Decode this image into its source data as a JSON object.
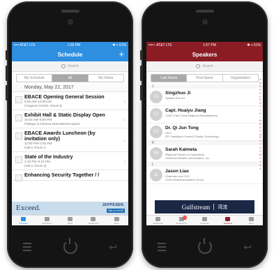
{
  "left": {
    "status": {
      "carrier": "•••• AT&T  LTE",
      "time": "1:58 PM",
      "battery": "✱ ⌖ 61%"
    },
    "title": "Schedule",
    "add_label": "+",
    "search_placeholder": "Search",
    "segments": [
      "My Schedule",
      "All",
      "My Notes"
    ],
    "active_segment": "All",
    "date": "Monday, May 22, 2017",
    "sessions": [
      {
        "title": "EBACE Opening General Session",
        "time": "9:00 AM–10:00 AM",
        "location": "Congress Centre, Room B"
      },
      {
        "title": "Exhibit Hall & Static Display Open",
        "time": "10:00 AM–6:00 PM",
        "location": "Palexpo & Geneva International Airport"
      },
      {
        "title": "EBACE Awards Luncheon (by invitation only)",
        "time": "12:00 PM–2:00 PM",
        "location": "Hall 3, Room V"
      },
      {
        "title": "State of the Industry",
        "time": "2:15 PM–3:15 PM",
        "location": "Hall 3, Room Q"
      },
      {
        "title": "Enhancing Security Together / /",
        "time": "",
        "location": ""
      }
    ],
    "ad": {
      "headline": "Exceed.",
      "brand": "JEPPESEN.",
      "cta": "Visit us at E48"
    },
    "tabs": [
      "Schedule",
      "Exhibitors",
      "Maps",
      "Dashboard",
      "More"
    ]
  },
  "right": {
    "status": {
      "carrier": "••••○ AT&T  LTE",
      "time": "1:57 PM",
      "battery": "✱ ⌖ 61%"
    },
    "title": "Speakers",
    "search_placeholder": "Search",
    "segments": [
      "Last Name",
      "First Name",
      "Organization"
    ],
    "active_segment": "Last Name",
    "letters": [
      "J",
      "K",
      "L"
    ],
    "speakers": [
      {
        "initials": "XJ",
        "name": "Xingzhuo Ji",
        "line1": "Sparkle Roll Jet",
        "line2": ""
      },
      {
        "initials": "CJ",
        "name": "Capt. Huaiyu Jiang",
        "line1": "CAAC East China Regional Administration",
        "line2": ""
      },
      {
        "initials": "DJ",
        "name": "Dr. Qi Jun Tong",
        "line1": "CEO",
        "line2": "EFY Intelligent Control (Tianjin) Technology..."
      },
      {
        "initials": "SK",
        "name": "Sarah Kalmeta",
        "line1": "Regional Director of Operations",
        "line2": "Universal Weather and Aviation, Inc"
      },
      {
        "initials": "JL",
        "name": "Jason Liao",
        "line1": "Chairman and CEO",
        "line2": "China Business Aviation Group"
      }
    ],
    "alphabet": [
      "A",
      "B",
      "C",
      "D",
      "E",
      "F",
      "G",
      "H",
      "I",
      "J",
      "K",
      "L",
      "M",
      "N",
      "O",
      "P",
      "Q",
      "R",
      "S",
      "T",
      "U",
      "V",
      "W",
      "X",
      "Y",
      "Z",
      "#"
    ],
    "ad": {
      "brand": "Gulfstream",
      "chinese": "湾流"
    },
    "tabs": [
      "Dashboard",
      "Notifications",
      "Schedule",
      "Speakers",
      "More"
    ],
    "notification_count": "13"
  },
  "colors": {
    "schedule_blue": "#2e8ee0",
    "speakers_red": "#8b1c24"
  }
}
